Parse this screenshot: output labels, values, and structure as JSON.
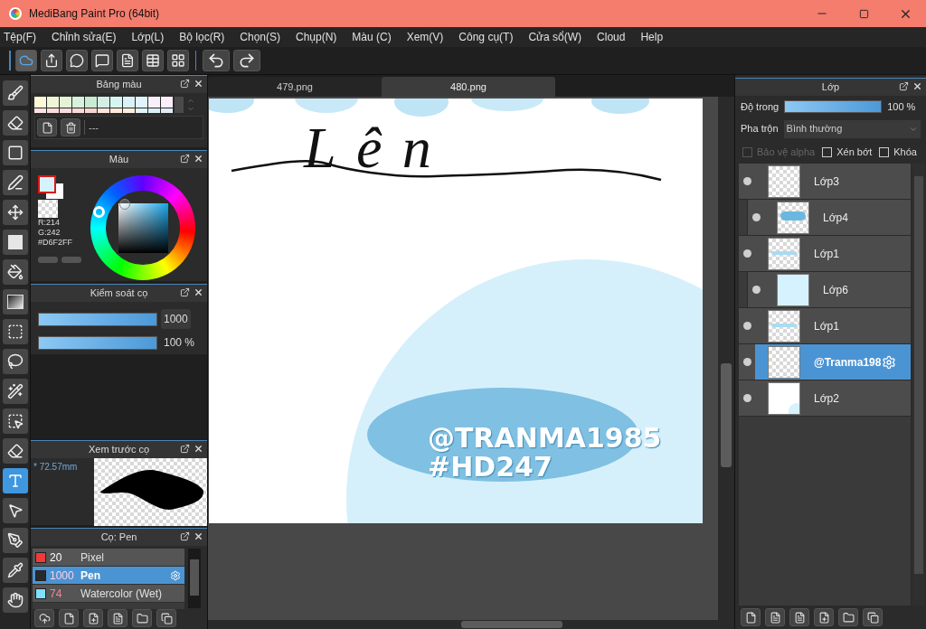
{
  "window": {
    "title": "MediBang Paint Pro (64bit)"
  },
  "menu": [
    "Tệp(F)",
    "Chỉnh sửa(E)",
    "Lớp(L)",
    "Bộ lọc(R)",
    "Chọn(S)",
    "Chụp(N)",
    "Màu (C)",
    "Xem(V)",
    "Công cụ(T)",
    "Cửa sổ(W)",
    "Cloud",
    "Help"
  ],
  "toolbar": [
    {
      "kind": "cloud",
      "selected": true
    },
    {
      "kind": "share",
      "selected": false
    },
    {
      "kind": "speech",
      "selected": false
    },
    {
      "kind": "message",
      "selected": false
    },
    {
      "kind": "page",
      "selected": false
    },
    {
      "kind": "table",
      "selected": false
    },
    {
      "kind": "grid",
      "selected": false
    },
    {
      "kind": "undo",
      "selected": false
    },
    {
      "kind": "redo",
      "selected": false
    }
  ],
  "tools": [
    {
      "kind": "brush",
      "selected": false
    },
    {
      "kind": "eraser",
      "selected": false
    },
    {
      "kind": "rect",
      "selected": false
    },
    {
      "kind": "dotpen",
      "selected": false
    },
    {
      "kind": "move",
      "selected": false
    },
    {
      "kind": "fill",
      "selected": false
    },
    {
      "kind": "bucket",
      "selected": false
    },
    {
      "kind": "gradient",
      "selected": false
    },
    {
      "kind": "select",
      "selected": false
    },
    {
      "kind": "lasso",
      "selected": false
    },
    {
      "kind": "wand",
      "selected": false
    },
    {
      "kind": "selectpen",
      "selected": false
    },
    {
      "kind": "selecteraser",
      "selected": false
    },
    {
      "kind": "text",
      "selected": true
    },
    {
      "kind": "operation",
      "selected": false
    },
    {
      "kind": "divide",
      "selected": false
    },
    {
      "kind": "eyedropper",
      "selected": false
    },
    {
      "kind": "hand",
      "selected": false
    }
  ],
  "palette": {
    "title": "Bảng màu",
    "swatches": [
      {
        "color": "#fdf8d6"
      },
      {
        "color": "#eef6d6"
      },
      {
        "color": "#e3f3d6"
      },
      {
        "color": "#d6f2dc"
      },
      {
        "color": "#c9ebd3"
      },
      {
        "color": "#d3efe5"
      },
      {
        "color": "#d6f4f2"
      },
      {
        "color": "#d9f2fa"
      },
      {
        "color": "#e1f3fc"
      },
      {
        "color": "#f7f0fb"
      },
      {
        "color": "#fbeefa"
      },
      {
        "color": "#fde3e3"
      },
      {
        "color": "#fbdede"
      },
      {
        "color": "#fbdcdc"
      },
      {
        "color": "#fcd9d9"
      },
      {
        "color": "#fbd4cf"
      },
      {
        "color": "#fde6dc"
      },
      {
        "color": "#fdebdb"
      },
      {
        "color": "#fdf0de"
      },
      {
        "color": "#e3f4fb"
      },
      {
        "color": "#d9f0f8"
      },
      {
        "color": "#dfeef6"
      }
    ],
    "set_name": "---"
  },
  "color_panel": {
    "title": "Màu",
    "foreground": {
      "color": "#d6f2ff"
    },
    "background": {
      "color": "#ffffff"
    },
    "values": [
      "R:214",
      "G:242",
      "#D6F2FF"
    ]
  },
  "brush_control": {
    "title": "Kiểm soát cọ",
    "sliders": [
      {
        "level": 1,
        "reading": "1000"
      },
      {
        "level": 1,
        "reading": "100 %"
      }
    ]
  },
  "brush_preview": {
    "title": "Xem trước cọ",
    "size": "* 72.57mm"
  },
  "brush_list": {
    "title": "Cọ: Pen",
    "items": [
      {
        "color": "#f03a3a",
        "size": "20",
        "name": "Pixel",
        "selected": false
      },
      {
        "color": "#2a2a2a",
        "size": "1000",
        "name": "Pen",
        "selected": true
      },
      {
        "color": "#7fe0ff",
        "size": "74",
        "name": "Watercolor (Wet)",
        "selected": false
      }
    ]
  },
  "tabs": [
    {
      "label": "479.png",
      "selected": false
    },
    {
      "label": "480.png",
      "selected": true
    }
  ],
  "canvas": {
    "title_text": "Lên",
    "watermark": [
      "@TRANMA1985",
      "#HD247"
    ]
  },
  "layers": {
    "title": "Lớp",
    "opacity": {
      "label": "Độ trong",
      "level": 1,
      "reading": "100 %"
    },
    "blend_label": "Pha trộn",
    "blend_value": "Bình thường",
    "options": [
      {
        "label": "Bảo vệ alpha",
        "checked": false,
        "disabled": true
      },
      {
        "label": "Xén bớt",
        "checked": false,
        "disabled": false
      },
      {
        "label": "Khóa",
        "checked": false,
        "disabled": false
      }
    ],
    "items": [
      {
        "name": "Lớp3",
        "thumbnail": {
          "kind": "transparent"
        },
        "clipped": false,
        "visible": true,
        "selected": false
      },
      {
        "name": "Lớp4",
        "thumbnail": {
          "kind": "stroke"
        },
        "clipped": true,
        "visible": true,
        "selected": false
      },
      {
        "name": "Lớp1",
        "thumbnail": {
          "kind": "scribble"
        },
        "clipped": false,
        "visible": true,
        "selected": false
      },
      {
        "name": "Lớp6",
        "thumbnail": {
          "kind": "light"
        },
        "clipped": true,
        "visible": true,
        "selected": false
      },
      {
        "name": "Lớp1",
        "thumbnail": {
          "kind": "scribble"
        },
        "clipped": false,
        "visible": true,
        "selected": false
      },
      {
        "name": "@Tranma198",
        "thumbnail": {
          "kind": "banner"
        },
        "clipped": false,
        "visible": true,
        "selected": true
      },
      {
        "name": "Lớp2",
        "thumbnail": {
          "kind": "white"
        },
        "clipped": false,
        "visible": true,
        "selected": false
      }
    ]
  }
}
